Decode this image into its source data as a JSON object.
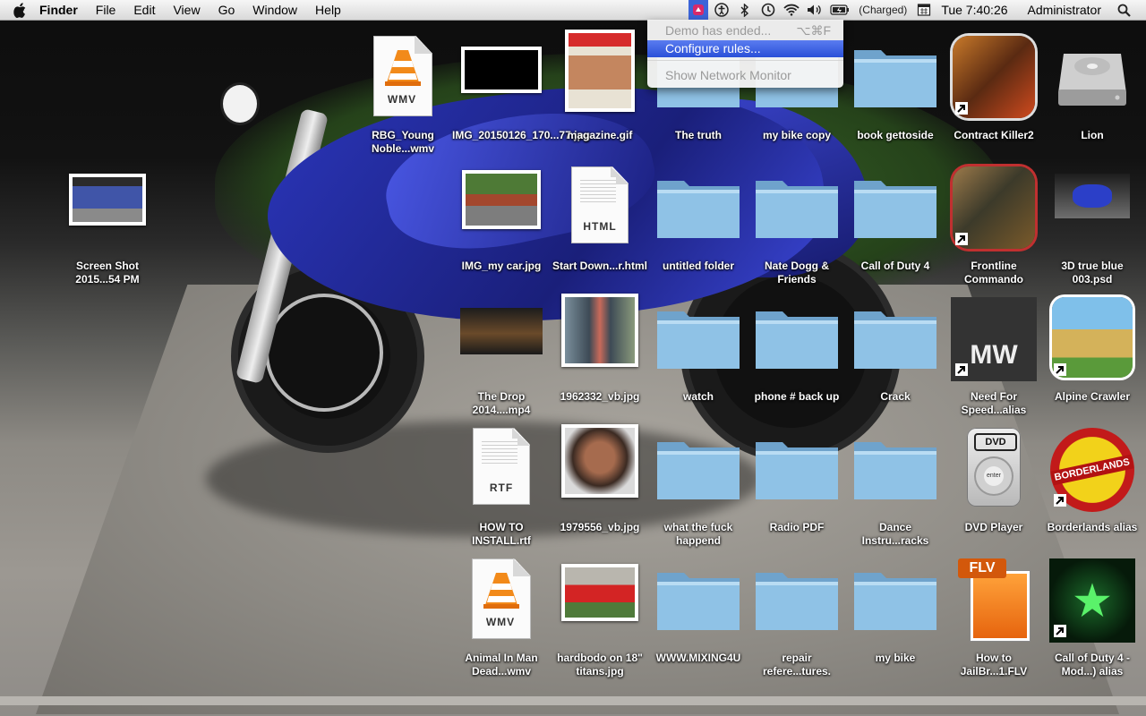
{
  "menubar": {
    "app": "Finder",
    "menus": [
      "File",
      "Edit",
      "View",
      "Go",
      "Window"
    ],
    "help": "Help",
    "battery_status": "(Charged)",
    "clock": "Tue 7:40:26",
    "user": "Administrator"
  },
  "dropdown": {
    "demo_ended": "Demo has ended...",
    "demo_shortcut": "⌥⌘F",
    "configure_rules": "Configure rules...",
    "network_monitor": "Show Network Monitor"
  },
  "icons": [
    {
      "label": "RBG_Young Noble...wmv",
      "kind": "vlc",
      "tag": "WMV"
    },
    {
      "label": "IMG_20150126_170...77.jpg",
      "kind": "photo-dark"
    },
    {
      "label": "magazine.gif",
      "kind": "magazine"
    },
    {
      "label": "The truth",
      "kind": "folder"
    },
    {
      "label": "my bike copy",
      "kind": "folder"
    },
    {
      "label": "book gettoside",
      "kind": "folder"
    },
    {
      "label": "Contract Killer2",
      "kind": "app-ck2"
    },
    {
      "label": "Lion",
      "kind": "harddrive"
    },
    {
      "label": "Screen Shot 2015...54 PM",
      "kind": "screenshot"
    },
    {
      "label": "IMG_my car.jpg",
      "kind": "photo-car"
    },
    {
      "label": "Start Down...r.html",
      "kind": "doc",
      "tag": "HTML"
    },
    {
      "label": "untitled folder",
      "kind": "folder"
    },
    {
      "label": "Nate Dogg & Friends",
      "kind": "folder"
    },
    {
      "label": "Call of Duty 4",
      "kind": "folder"
    },
    {
      "label": "Frontline Commando",
      "kind": "app-fc"
    },
    {
      "label": "3D true blue 003.psd",
      "kind": "psd"
    },
    {
      "label": "The Drop 2014....mp4",
      "kind": "video-drop"
    },
    {
      "label": "1962332_vb.jpg",
      "kind": "photo-person"
    },
    {
      "label": "watch",
      "kind": "folder"
    },
    {
      "label": "phone # back up",
      "kind": "folder"
    },
    {
      "label": "Crack",
      "kind": "folder"
    },
    {
      "label": "Need For Speed...alias",
      "kind": "app-nfs"
    },
    {
      "label": "Alpine Crawler",
      "kind": "app-alpine"
    },
    {
      "label": "HOW TO INSTALL.rtf",
      "kind": "doc",
      "tag": "RTF"
    },
    {
      "label": "1979556_vb.jpg",
      "kind": "photo-face"
    },
    {
      "label": "what the fuck happend",
      "kind": "folder"
    },
    {
      "label": "Radio PDF",
      "kind": "folder"
    },
    {
      "label": "Dance Instru...racks",
      "kind": "folder"
    },
    {
      "label": "DVD Player",
      "kind": "dvd"
    },
    {
      "label": "Borderlands alias",
      "kind": "app-borderlands"
    },
    {
      "label": "Animal In Man Dead...wmv",
      "kind": "vlc",
      "tag": "WMV"
    },
    {
      "label": "hardbodo on 18\" titans.jpg",
      "kind": "photo-truck"
    },
    {
      "label": "WWW.MIXING4U",
      "kind": "folder"
    },
    {
      "label": "repair refere...tures.",
      "kind": "folder"
    },
    {
      "label": "my bike",
      "kind": "folder"
    },
    {
      "label": "How to JailBr...1.FLV",
      "kind": "flv",
      "tag": "FLV"
    },
    {
      "label": "Call of Duty 4 - Mod...) alias",
      "kind": "app-cod4"
    }
  ],
  "dvd_text": "DVD",
  "dvd_enter": "enter",
  "borderlands_text": "BORDERLANDS",
  "nfs_text": "MW"
}
